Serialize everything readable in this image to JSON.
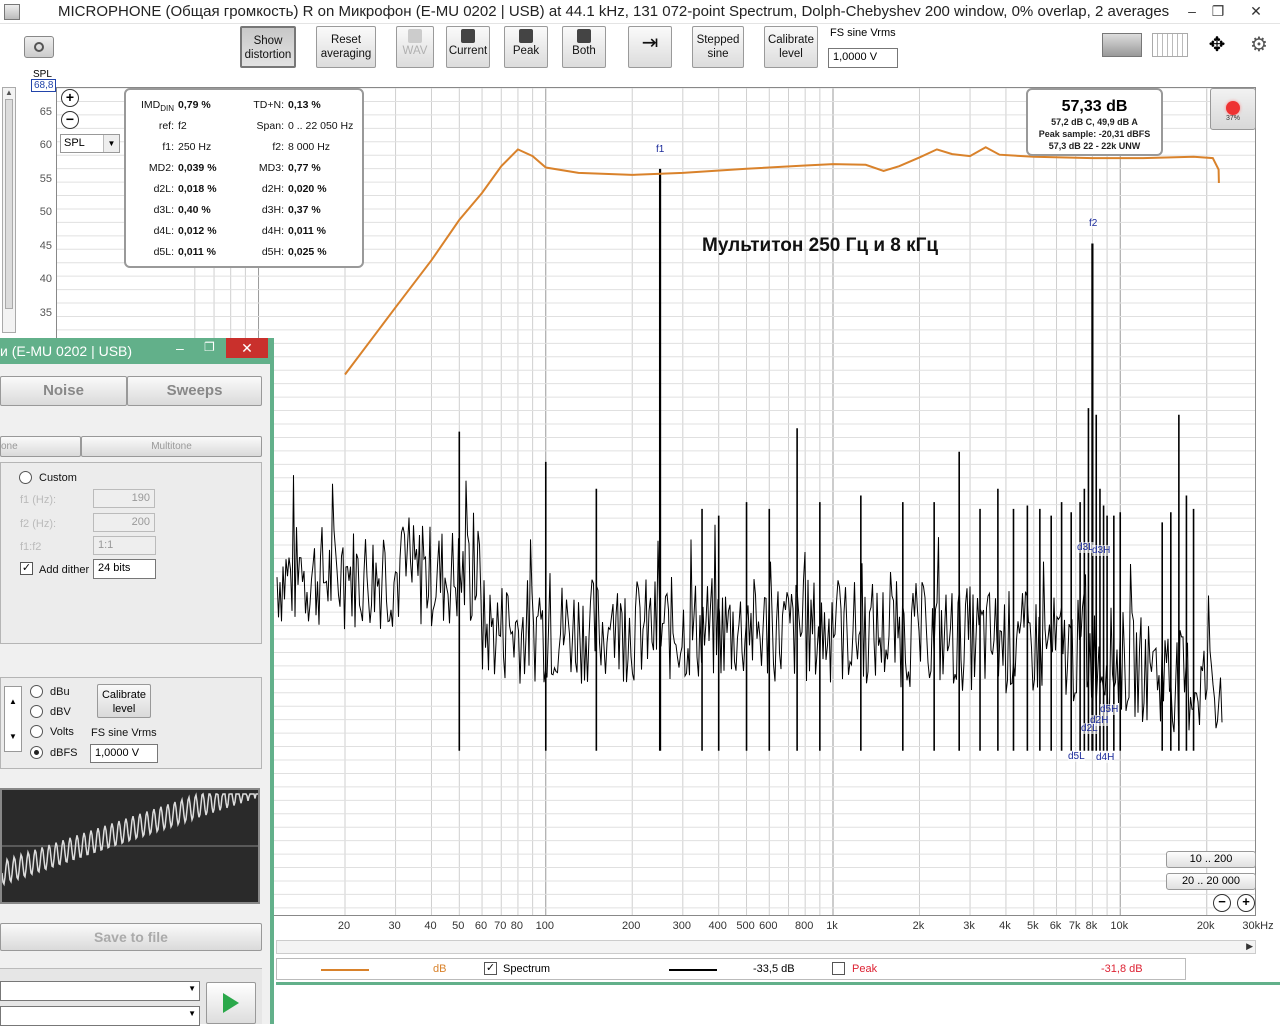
{
  "window": {
    "title": "MICROPHONE (Общая громкость) R on Микрофон (E-MU 0202 | USB) at 44.1 kHz, 131 072-point Spectrum, Dolph-Chebyshev 200 window, 0% overlap, 2 averages",
    "minimize": "–",
    "maximize": "❐",
    "close": "✕"
  },
  "toolbar": {
    "show_distortion": "Show distortion",
    "reset_averaging": "Reset averaging",
    "wav": "WAV",
    "current": "Current",
    "peak": "Peak",
    "both": "Both",
    "stepped_sine": "Stepped sine",
    "calibrate_level": "Calibrate level",
    "fs_label": "FS sine Vrms",
    "fs_value": "1,0000 V"
  },
  "yaxis": {
    "label": "SPL",
    "value": "68,8",
    "ticks": [
      "65",
      "60",
      "55",
      "50",
      "45",
      "40",
      "35"
    ],
    "select": "SPL"
  },
  "stats": {
    "rows": [
      {
        "k1": "IMD",
        "k1sub": "DIN",
        "v1": "0,79 %",
        "k2": "TD+N:",
        "v2": "0,13 %"
      },
      {
        "k1": "ref:",
        "v1": "f2",
        "k2": "Span:",
        "v2": "0 .. 22 050 Hz",
        "light": true
      },
      {
        "k1": "f1:",
        "v1": "250 Hz",
        "k2": "f2:",
        "v2": "8 000 Hz",
        "light": true
      },
      {
        "k1": "MD2:",
        "v1": "0,039 %",
        "k2": "MD3:",
        "v2": "0,77 %"
      },
      {
        "k1": "d2L:",
        "v1": "0,018 %",
        "k2": "d2H:",
        "v2": "0,020 %"
      },
      {
        "k1": "d3L:",
        "v1": "0,40 %",
        "k2": "d3H:",
        "v2": "0,37 %"
      },
      {
        "k1": "d4L:",
        "v1": "0,012 %",
        "k2": "d4H:",
        "v2": "0,011 %"
      },
      {
        "k1": "d5L:",
        "v1": "0,011 %",
        "k2": "d5H:",
        "v2": "0,025 %"
      }
    ]
  },
  "level": {
    "main": "57,33 dB",
    "line1": "57,2 dB C, 49,9 dB A",
    "line2": "Peak sample: -20,31 dBFS",
    "line3": "57,3 dB 22 - 22k UNW"
  },
  "record": {
    "pct": "37%"
  },
  "annotation": "Мультитон 250 Гц и 8 кГц",
  "peak_labels": {
    "f1": "f1",
    "f2": "f2",
    "d3l": "d3L",
    "d3h": "d3H",
    "d5h": "d5H",
    "d2h": "d2H",
    "d2l": "d2L",
    "d5l": "d5L",
    "d4h": "d4H"
  },
  "xaxis": {
    "ticks": [
      "20",
      "30",
      "40",
      "50",
      "60",
      "70",
      "80",
      "100",
      "200",
      "300",
      "400",
      "500",
      "600",
      "800",
      "1k",
      "2k",
      "3k",
      "4k",
      "5k",
      "6k",
      "7k",
      "8k",
      "10k",
      "20k",
      "30kHz"
    ]
  },
  "ranges": {
    "r1": "10 .. 200",
    "r2": "20 .. 20 000"
  },
  "legend": {
    "db_label": "dB",
    "spectrum_label": "Spectrum",
    "spectrum_value": "-33,5 dB",
    "peak_label": "Peak",
    "peak_value": "-31,8 dB"
  },
  "generator": {
    "title": "и (E-MU 0202 | USB)",
    "tab_noise": "Noise",
    "tab_sweeps": "Sweeps",
    "subtab_tone": "one",
    "subtab_multitone": "Multitone",
    "custom": "Custom",
    "f1_label": "f1 (Hz):",
    "f1_value": "190",
    "f2_label": "f2 (Hz):",
    "f2_value": "200",
    "ratio_label": "f1:f2",
    "ratio_value": "1:1",
    "add_dither": "Add dither",
    "dither_value": "24 bits",
    "dbu": "dBu",
    "dbv": "dBV",
    "volts": "Volts",
    "dbfs": "dBFS",
    "calibrate": "Calibrate level",
    "fs_label": "FS sine Vrms",
    "fs_value": "1,0000 V",
    "save": "Save to file"
  },
  "colors": {
    "response_curve": "#d9822b",
    "spectrum": "#000000",
    "peak_label": "#1a2a9a",
    "generator_frame": "#62b08a"
  }
}
